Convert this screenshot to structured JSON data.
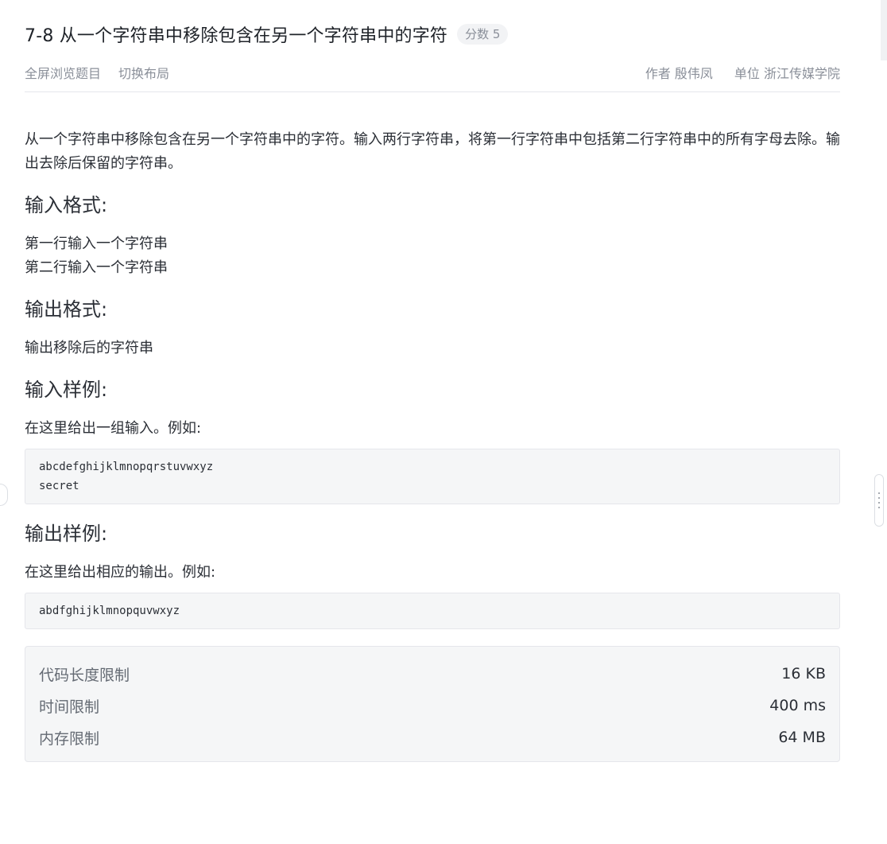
{
  "problem": {
    "title": "7-8 从一个字符串中移除包含在另一个字符串中的字符",
    "score_badge": "分数 5"
  },
  "toolbar": {
    "fullscreen_label": "全屏浏览题目",
    "switch_layout_label": "切换布局",
    "author_label": "作者 殷伟凤",
    "unit_label": "单位 浙江传媒学院"
  },
  "description": "从一个字符串中移除包含在另一个字符串中的字符。输入两行字符串，将第一行字符串中包括第二行字符串中的所有字母去除。输出去除后保留的字符串。",
  "input_format": {
    "heading": "输入格式:",
    "lines": [
      "第一行输入一个字符串",
      "第二行输入一个字符串"
    ]
  },
  "output_format": {
    "heading": "输出格式:",
    "lines": [
      "输出移除后的字符串"
    ]
  },
  "input_sample": {
    "heading": "输入样例:",
    "intro": "在这里给出一组输入。例如:",
    "code_lines": [
      "abcdefghijklmnopqrstuvwxyz",
      "secret"
    ]
  },
  "output_sample": {
    "heading": "输出样例:",
    "intro": "在这里给出相应的输出。例如:",
    "code_lines": [
      "abdfghijklmnopquvwxyz"
    ]
  },
  "limits": [
    {
      "label": "代码长度限制",
      "value": "16 KB"
    },
    {
      "label": "时间限制",
      "value": "400 ms"
    },
    {
      "label": "内存限制",
      "value": "64 MB"
    }
  ]
}
